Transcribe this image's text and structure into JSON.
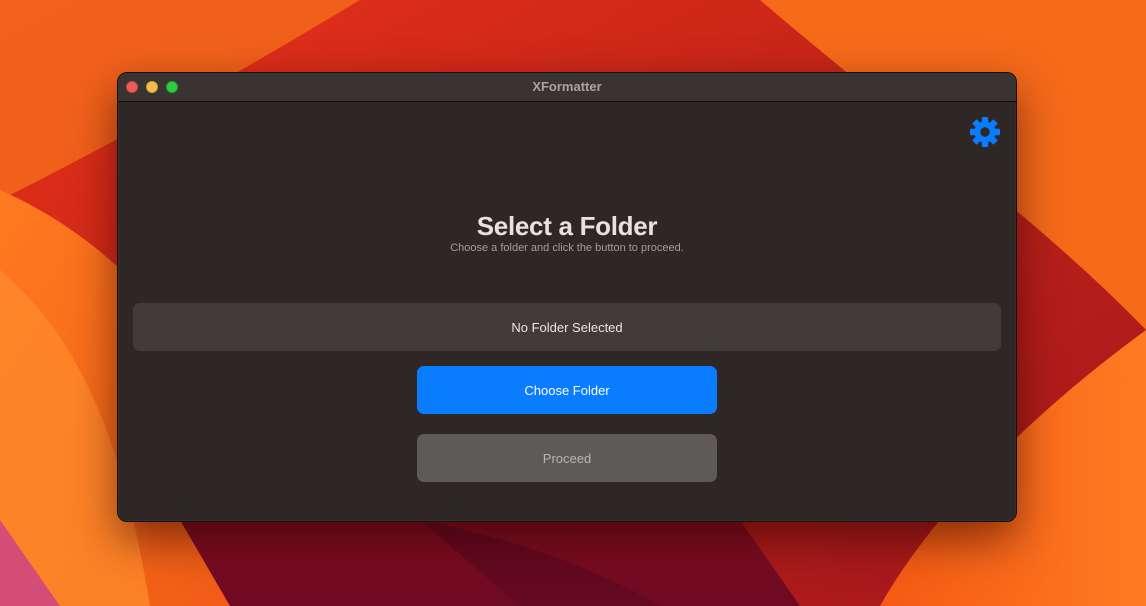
{
  "window": {
    "title": "XFormatter"
  },
  "titlebar": {
    "buttons": [
      {
        "name": "close",
        "color": "#ed5e58"
      },
      {
        "name": "minimize",
        "color": "#f4bd4f"
      },
      {
        "name": "zoom",
        "color": "#2fc943"
      }
    ]
  },
  "settings": {
    "icon": "gear-icon",
    "color": "#0a7cff"
  },
  "main": {
    "title": "Select a Folder",
    "subtitle": "Choose a folder and click the button to proceed.",
    "folder_status": "No Folder Selected",
    "choose_button_label": "Choose Folder",
    "proceed_button_label": "Proceed",
    "proceed_enabled": false
  },
  "colors": {
    "accent": "#0a7cff",
    "window_background": "#2f2726"
  }
}
